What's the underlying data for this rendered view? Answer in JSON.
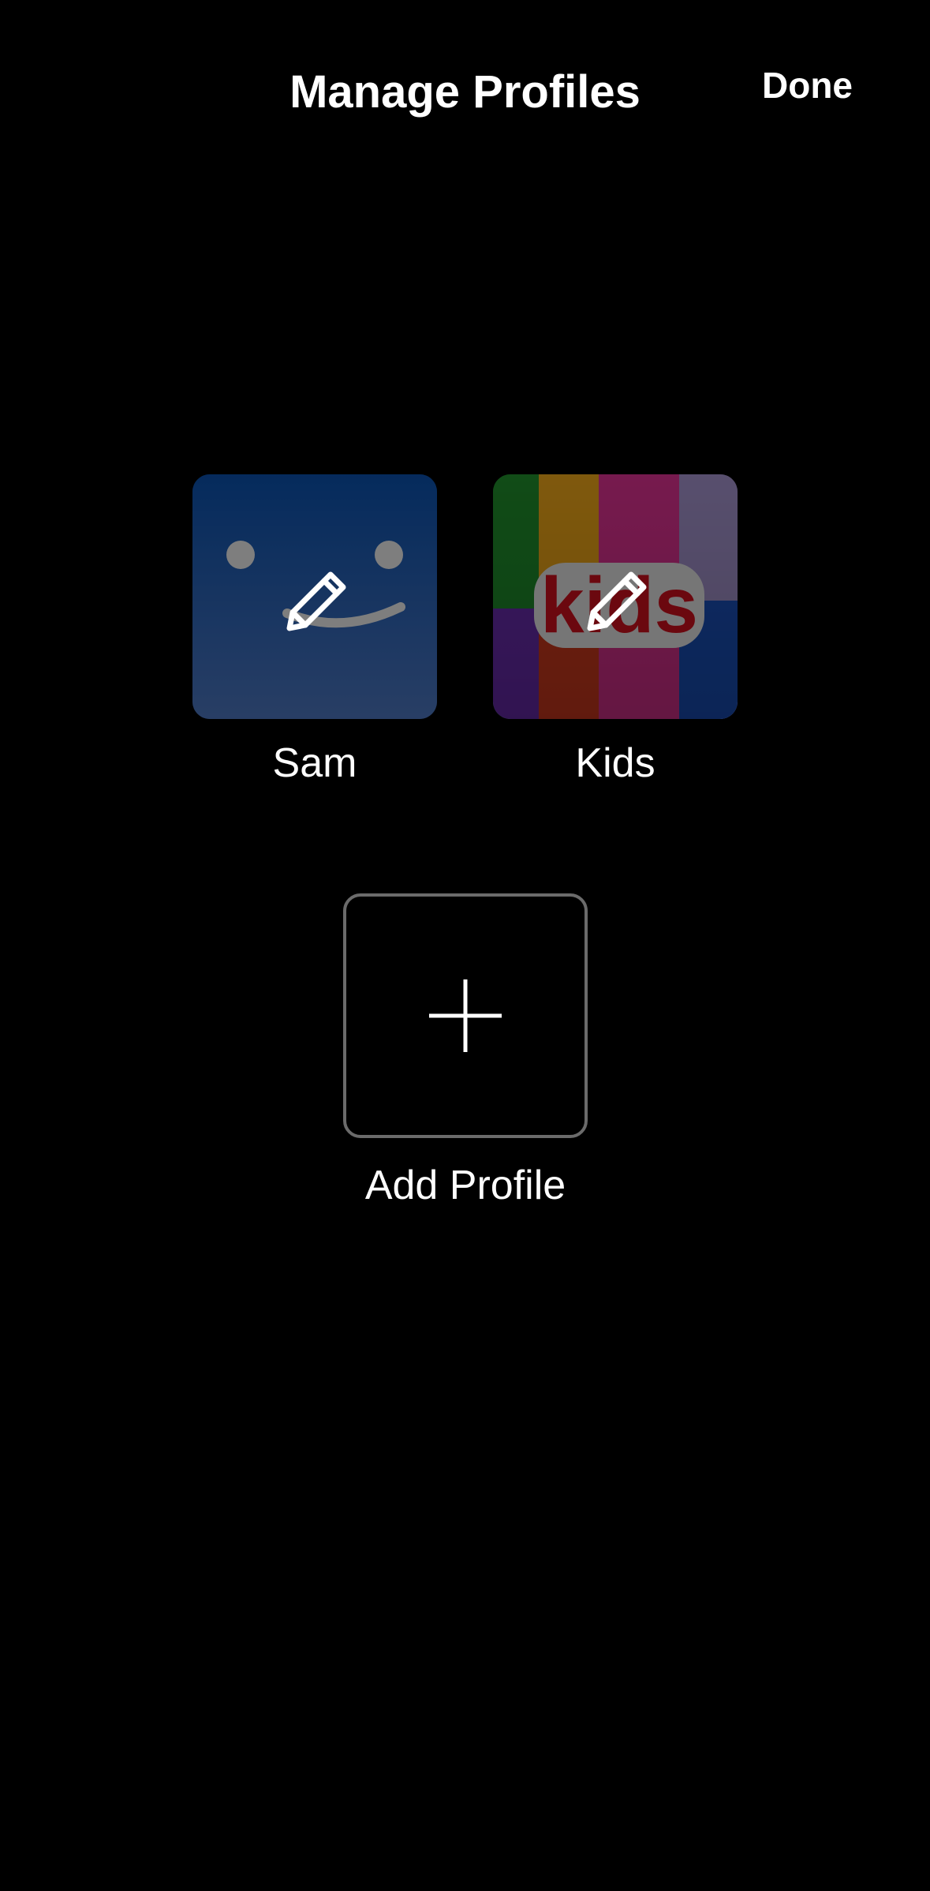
{
  "header": {
    "title": "Manage Profiles",
    "done_label": "Done"
  },
  "profiles": [
    {
      "name": "Sam",
      "avatar": "smiley-face-avatar",
      "overlay_icon": "pencil-edit-icon",
      "color": "#2b5aa8"
    },
    {
      "name": "Kids",
      "avatar": "kids-rainbow-avatar",
      "overlay_icon": "pencil-edit-icon",
      "avatar_text": "kids"
    }
  ],
  "add_profile": {
    "label": "Add Profile",
    "icon": "plus-icon",
    "border_color": "#6b6b6b"
  },
  "colors": {
    "background": "#000000",
    "text": "#ffffff"
  }
}
